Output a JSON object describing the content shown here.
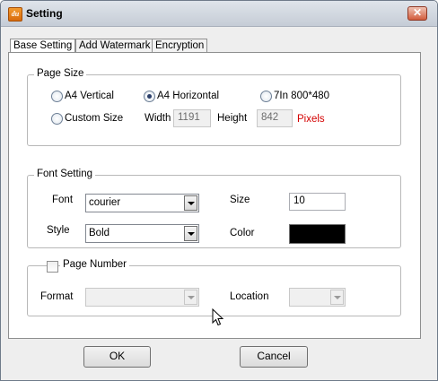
{
  "window": {
    "title": "Setting",
    "icon": "app-logo-icon",
    "close_glyph": "✕"
  },
  "tabs": [
    {
      "label": "Base Setting",
      "active": true
    },
    {
      "label": "Add Watermark",
      "active": false
    },
    {
      "label": "Encryption",
      "active": false
    }
  ],
  "page_size": {
    "group_title": "Page Size",
    "options": [
      {
        "label": "A4 Vertical",
        "checked": false
      },
      {
        "label": "A4 Horizontal",
        "checked": true
      },
      {
        "label": "7In 800*480",
        "checked": false
      },
      {
        "label": "Custom Size",
        "checked": false
      }
    ],
    "width_label": "Width",
    "width_value": "1191",
    "height_label": "Height",
    "height_value": "842",
    "unit_label": "Pixels",
    "unit_color": "#d40000"
  },
  "font_setting": {
    "group_title": "Font Setting",
    "font_label": "Font",
    "font_value": "courier",
    "size_label": "Size",
    "size_value": "10",
    "style_label": "Style",
    "style_value": "Bold",
    "color_label": "Color",
    "color_value": "#000000"
  },
  "page_number": {
    "checkbox_label": "Page Number",
    "checked": false,
    "format_label": "Format",
    "format_value": "",
    "location_label": "Location",
    "location_value": ""
  },
  "buttons": {
    "ok_label": "OK",
    "cancel_label": "Cancel"
  }
}
